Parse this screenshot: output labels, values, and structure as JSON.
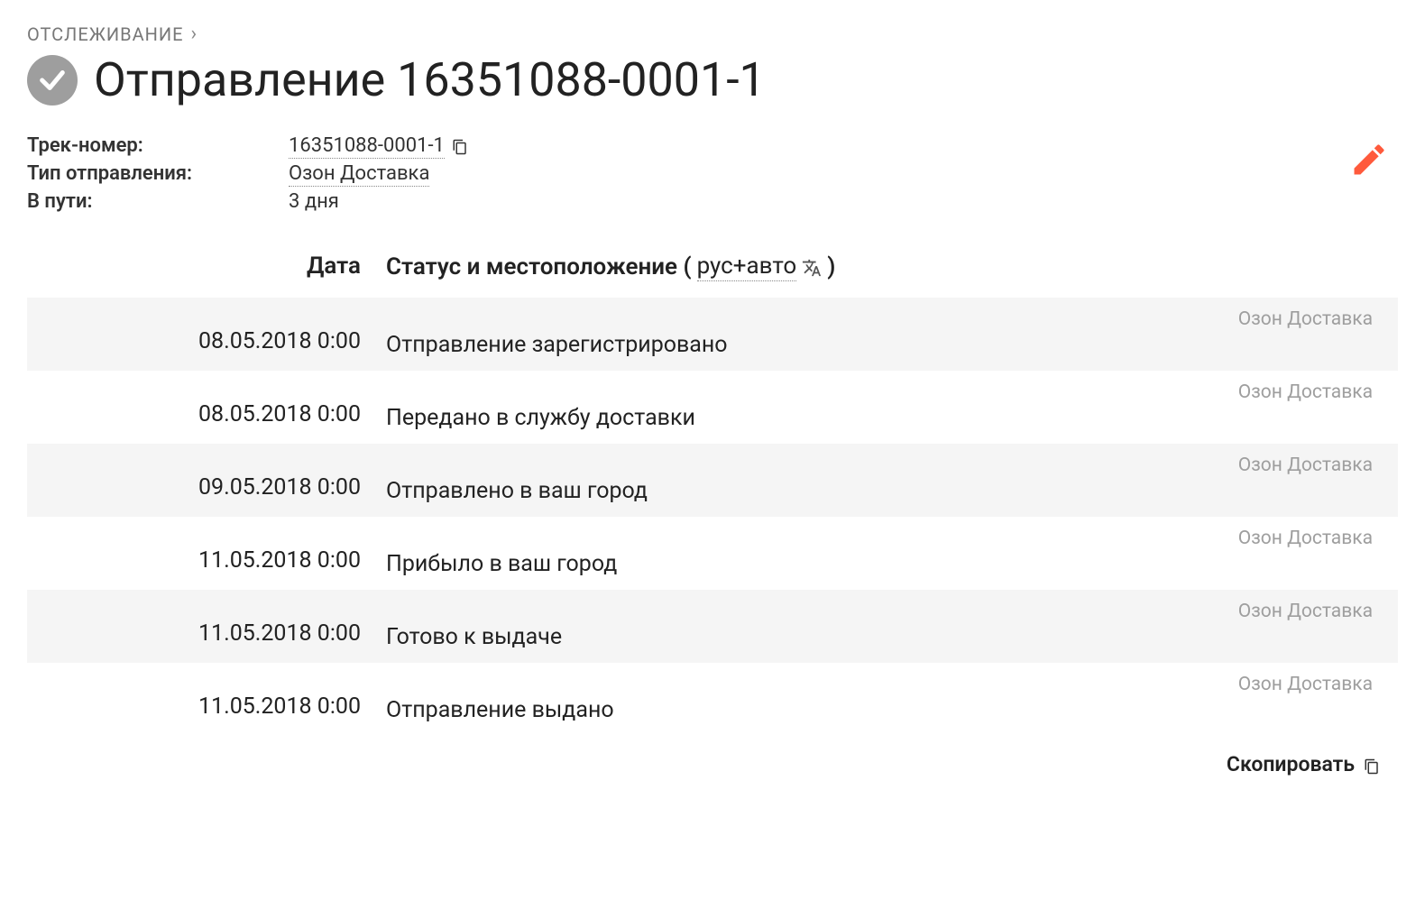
{
  "breadcrumb": {
    "root": "ОТСЛЕЖИВАНИЕ"
  },
  "title": "Отправление 16351088-0001-1",
  "meta": {
    "track_label": "Трек-номер:",
    "track_value": "16351088-0001-1",
    "type_label": "Тип отправления:",
    "type_value": "Озон Доставка",
    "transit_label": "В пути:",
    "transit_value": "3 дня"
  },
  "columns": {
    "date": "Дата",
    "status_prefix": "Статус и местоположение (",
    "lang": "рус+авто",
    "status_suffix": ")"
  },
  "rows": [
    {
      "date": "08.05.2018 0:00",
      "status": "Отправление зарегистрировано",
      "carrier": "Озон Доставка"
    },
    {
      "date": "08.05.2018 0:00",
      "status": "Передано в службу доставки",
      "carrier": "Озон Доставка"
    },
    {
      "date": "09.05.2018 0:00",
      "status": "Отправлено в ваш город",
      "carrier": "Озон Доставка"
    },
    {
      "date": "11.05.2018 0:00",
      "status": "Прибыло в ваш город",
      "carrier": "Озон Доставка"
    },
    {
      "date": "11.05.2018 0:00",
      "status": "Готово к выдаче",
      "carrier": "Озон Доставка"
    },
    {
      "date": "11.05.2018 0:00",
      "status": "Отправление выдано",
      "carrier": "Озон Доставка"
    }
  ],
  "copy_all": "Скопировать"
}
